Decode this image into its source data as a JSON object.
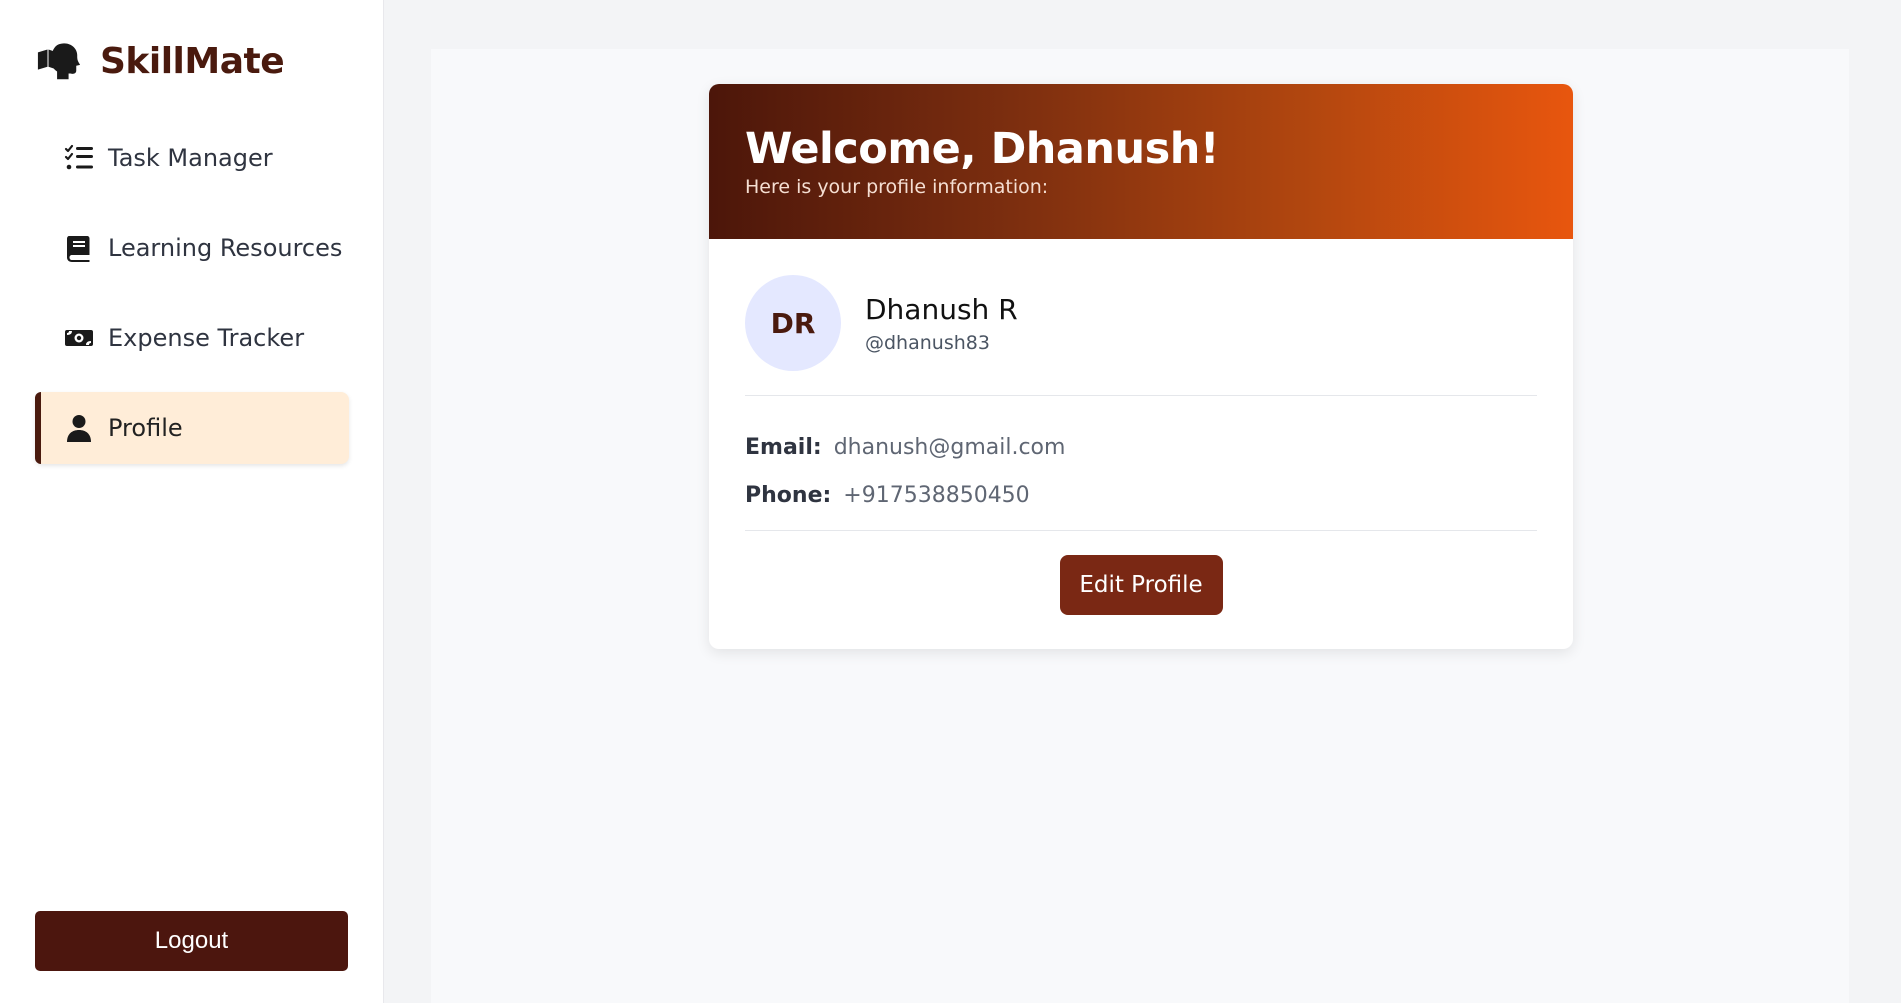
{
  "brand": {
    "name": "SkillMate",
    "logo_icon": "head-with-book-icon",
    "color": "#4a1a0e"
  },
  "sidebar": {
    "items": [
      {
        "label": "Task Manager",
        "icon": "checklist-icon",
        "active": false
      },
      {
        "label": "Learning Resources",
        "icon": "book-icon",
        "active": false
      },
      {
        "label": "Expense Tracker",
        "icon": "money-bill-icon",
        "active": false
      },
      {
        "label": "Profile",
        "icon": "user-icon",
        "active": true
      }
    ],
    "active_bg": "#ffedd8",
    "logout_label": "Logout"
  },
  "profile_card": {
    "welcome_title": "Welcome, Dhanush!",
    "subtitle": "Here is your profile information:",
    "header_gradient": [
      "#4c160a",
      "#e8560e"
    ],
    "avatar_initials": "DR",
    "avatar_bg": "#e4e8ff",
    "full_name": "Dhanush R",
    "username": "@dhanush83",
    "email_label": "Email:",
    "email": "dhanush@gmail.com",
    "phone_label": "Phone:",
    "phone": "+917538850450",
    "edit_button_label": "Edit Profile",
    "edit_button_color": "#7a2814"
  }
}
